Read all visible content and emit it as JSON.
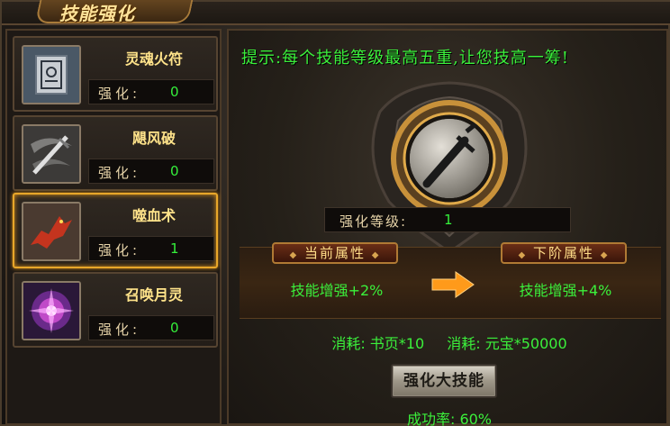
{
  "window": {
    "title": "技能强化"
  },
  "skills": [
    {
      "name": "灵魂火符",
      "enhance_label": "强化:",
      "enhance_value": "0",
      "icon": "talisman-icon",
      "selected": false
    },
    {
      "name": "飓风破",
      "enhance_label": "强化:",
      "enhance_value": "0",
      "icon": "sword-wind-icon",
      "selected": false
    },
    {
      "name": "噬血术",
      "enhance_label": "强化:",
      "enhance_value": "1",
      "icon": "blood-beast-icon",
      "selected": true
    },
    {
      "name": "召唤月灵",
      "enhance_label": "强化:",
      "enhance_value": "0",
      "icon": "moon-spirit-icon",
      "selected": false
    }
  ],
  "detail": {
    "tip": "提示:每个技能等级最高五重,让您技高一筹!",
    "emblem_icon": "sword-emblem-icon",
    "level_label": "强化等级:",
    "level_value": "1",
    "current_attr_title": "当前属性",
    "current_attr_value": "技能增强+2%",
    "next_attr_title": "下阶属性",
    "next_attr_value": "技能增强+4%",
    "cost1": "消耗: 书页*10",
    "cost2": "消耗: 元宝*50000",
    "button_label": "强化大技能",
    "success_rate": "成功率: 60%"
  },
  "colors": {
    "accent_green": "#3bf03b",
    "gold": "#ffe38a",
    "selected_border": "#e8a72a"
  }
}
